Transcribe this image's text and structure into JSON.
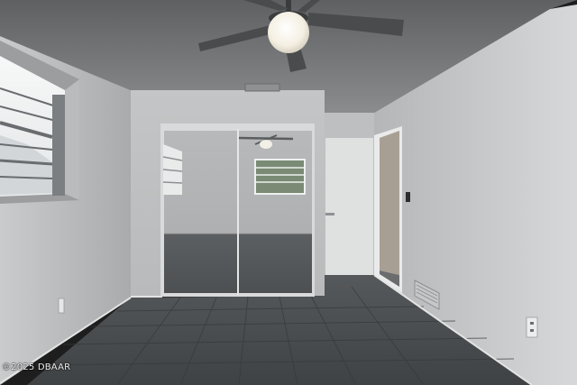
{
  "photo": {
    "watermark": "©2025 DBAAR"
  }
}
